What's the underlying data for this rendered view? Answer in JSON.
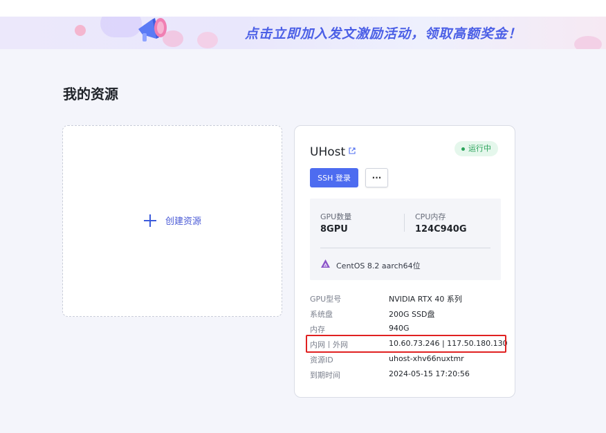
{
  "banner": {
    "text": "点击立即加入发文激励活动，领取高额奖金！",
    "icon": "megaphone-icon"
  },
  "page_title": "我的资源",
  "create_card": {
    "label": "创建资源",
    "icon": "plus-icon"
  },
  "host": {
    "name": "UHost",
    "status": "运行中",
    "ssh_button": "SSH 登录",
    "more_button": "···",
    "specs": {
      "gpu_label": "GPU数量",
      "gpu_value": "8GPU",
      "cpu_label": "CPU内存",
      "cpu_value": "124C940G",
      "os": "CentOS 8.2 aarch64位"
    },
    "details": [
      {
        "key": "GPU型号",
        "value": "NVIDIA RTX 40 系列"
      },
      {
        "key": "系统盘",
        "value": "200G SSD盘"
      },
      {
        "key": "内存",
        "value": "940G"
      },
      {
        "key": "内网丨外网",
        "value": "10.60.73.246 | 117.50.180.130"
      },
      {
        "key": "资源ID",
        "value": "uhost-xhv66nuxtmr"
      },
      {
        "key": "到期时间",
        "value": "2024-05-15 17:20:56"
      }
    ]
  },
  "colors": {
    "accent": "#4d6cf0",
    "status_green": "#2aa35a",
    "highlight_red": "#e02020"
  }
}
